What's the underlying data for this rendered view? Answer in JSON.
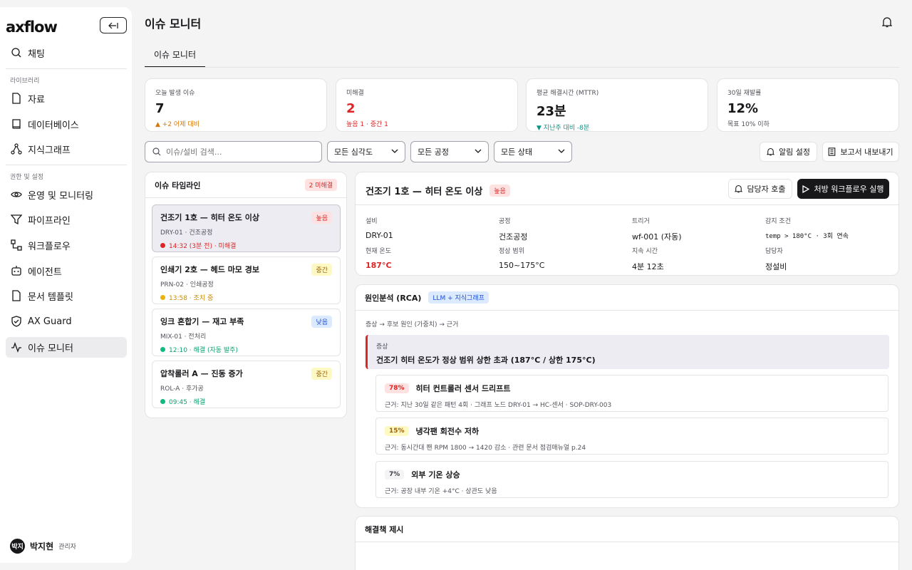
{
  "brand": {
    "logo": "axflow"
  },
  "sidebar": {
    "chat": "채팅",
    "library_section": "라이브러리",
    "library_items": [
      "자료",
      "데이터베이스",
      "지식그래프"
    ],
    "admin_section": "권한 및 설정",
    "admin_items": [
      "운영 및 모니터링",
      "파이프라인",
      "워크플로우",
      "에이전트",
      "문서 템플릿",
      "AX Guard",
      "이슈 모니터"
    ],
    "user": {
      "initials": "박지",
      "name": "박지현",
      "role": "관리자"
    }
  },
  "header": {
    "title": "이슈 모니터",
    "tab": "이슈 모니터"
  },
  "kpis": [
    {
      "label": "오늘 발생 이슈",
      "value": "7",
      "sub": "▲ +2 어제 대비",
      "sub_color": "#d97706",
      "value_color": "#18181b"
    },
    {
      "label": "미해결",
      "value": "2",
      "sub": "높음 1 · 중간 1",
      "sub_color": "#dc2626",
      "value_color": "#dc2626"
    },
    {
      "label": "평균 해결시간 (MTTR)",
      "value": "23분",
      "sub": "▼ 지난주 대비 -8분",
      "sub_color": "#0d9488",
      "value_color": "#18181b"
    },
    {
      "label": "30일 재발률",
      "value": "12%",
      "sub": "목표 10% 이하",
      "sub_color": "#52525b",
      "value_color": "#18181b"
    }
  ],
  "filters": {
    "search_placeholder": "이슈/설비 검색...",
    "severity": "모든 심각도",
    "process": "모든 공정",
    "status": "모든 상태",
    "alert_btn": "알림 설정",
    "export_btn": "보고서 내보내기"
  },
  "timeline": {
    "title": "이슈 타임라인",
    "badge": "2 미해결",
    "items": [
      {
        "title": "건조기 1호 — 히터 온도 이상",
        "meta": "DRY-01 · 건조공정",
        "status": "14:32 (3분 전) · 미해결",
        "badge": "높음",
        "dot": "#dc2626",
        "status_color": "#dc2626"
      },
      {
        "title": "인쇄기 2호 — 헤드 마모 경보",
        "meta": "PRN-02 · 인쇄공정",
        "status": "13:58 · 조치 중",
        "badge": "중간",
        "dot": "#eab308",
        "status_color": "#ca8a04"
      },
      {
        "title": "잉크 혼합기 — 재고 부족",
        "meta": "MIX-01 · 전처리",
        "status": "12:10 · 해결 (자동 발주)",
        "badge": "낮음",
        "dot": "#10b981",
        "status_color": "#0f9f6e"
      },
      {
        "title": "압착롤러 A — 진동 증가",
        "meta": "ROL-A · 후가공",
        "status": "09:45 · 해결",
        "badge": "중간",
        "dot": "#10b981",
        "status_color": "#0f9f6e"
      }
    ]
  },
  "detail": {
    "title": "건조기 1호 — 히터 온도 이상",
    "badge": "높음",
    "call_btn": "담당자 호출",
    "run_btn": "처방 워크플로우 실행",
    "fields": [
      {
        "label": "설비",
        "value": "DRY-01"
      },
      {
        "label": "공정",
        "value": "건조공정"
      },
      {
        "label": "트리거",
        "value": "wf-001 (자동)"
      },
      {
        "label": "감지 조건",
        "value": "temp > 180°C · 3회 연속"
      },
      {
        "label": "현재 온도",
        "value": "187°C"
      },
      {
        "label": "정상 범위",
        "value": "150~175°C"
      },
      {
        "label": "지속 시간",
        "value": "4분 12초"
      },
      {
        "label": "담당자",
        "value": "정설비"
      }
    ]
  },
  "rca": {
    "title": "원인분석 (RCA)",
    "badge": "LLM + 지식그래프",
    "flow": "증상 → 후보 원인 (가중치) → 근거",
    "symptom_label": "증상",
    "symptom": "건조기 히터 온도가 정상 범위 상한 초과 (187°C / 상한 175°C)",
    "causes": [
      {
        "pct": "78%",
        "title": "히터 컨트롤러 센서 드리프트",
        "evidence": "근거: 지난 30일 같은 패턴 4회 · 그래프 노드 DRY-01 → HC-센서 · SOP-DRY-003"
      },
      {
        "pct": "15%",
        "title": "냉각팬 회전수 저하",
        "evidence": "근거: 동시간대 팬 RPM 1800 → 1420 감소 · 관련 문서 점검매뉴얼 p.24"
      },
      {
        "pct": "7%",
        "title": "외부 기온 상승",
        "evidence": "근거: 공장 내부 기온 +4°C · 상관도 낮음"
      }
    ]
  },
  "solution": {
    "title": "해결책 제시"
  }
}
